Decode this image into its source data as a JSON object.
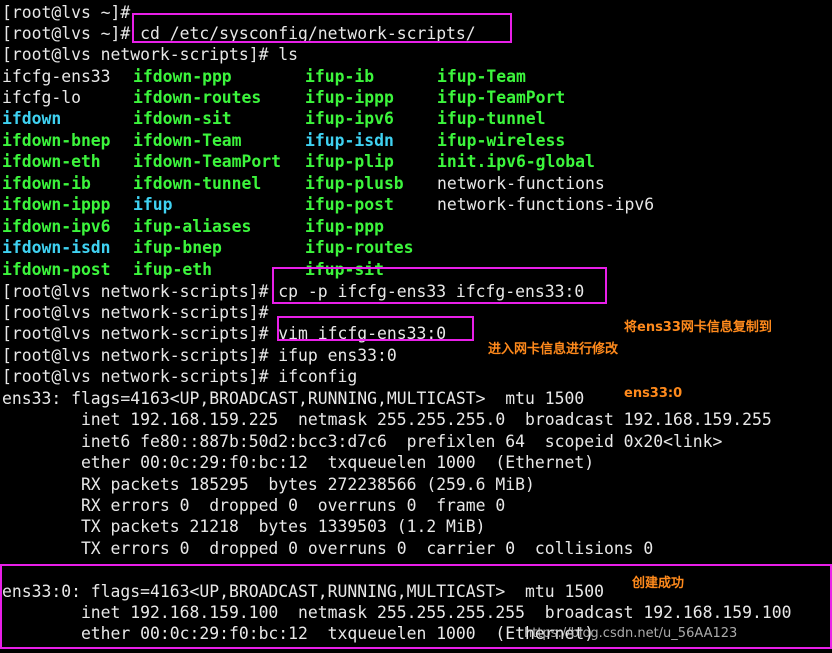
{
  "terminal": {
    "lines": [
      "[root@lvs ~]#",
      "[root@lvs ~]# cd /etc/sysconfig/network-scripts/",
      "[root@lvs network-scripts]# ls",
      "[root@lvs network-scripts]# cp -p ifcfg-ens33 ifcfg-ens33:0",
      "[root@lvs network-scripts]#",
      "[root@lvs network-scripts]# vim ifcfg-ens33:0",
      "[root@lvs network-scripts]# ifup ens33:0",
      "[root@lvs network-scripts]# ifconfig",
      "ens33: flags=4163<UP,BROADCAST,RUNNING,MULTICAST>  mtu 1500",
      "        inet 192.168.159.225  netmask 255.255.255.0  broadcast 192.168.159.255",
      "        inet6 fe80::887b:50d2:bcc3:d7c6  prefixlen 64  scopeid 0x20<link>",
      "        ether 00:0c:29:f0:bc:12  txqueuelen 1000  (Ethernet)",
      "        RX packets 185295  bytes 272238566 (259.6 MiB)",
      "        RX errors 0  dropped 0  overruns 0  frame 0",
      "        TX packets 21218  bytes 1339503 (1.2 MiB)",
      "        TX errors 0  dropped 0 overruns 0  carrier 0  collisions 0",
      "",
      "ens33:0: flags=4163<UP,BROADCAST,RUNNING,MULTICAST>  mtu 1500",
      "        inet 192.168.159.100  netmask 255.255.255.255  broadcast 192.168.159.100",
      "        ether 00:0c:29:f0:bc:12  txqueuelen 1000  (Ethernet)"
    ],
    "ls_columns": [
      [
        "ifcfg-ens33",
        "ifcfg-lo",
        "ifdown",
        "ifdown-bnep",
        "ifdown-eth",
        "ifdown-ib",
        "ifdown-ippp",
        "ifdown-ipv6",
        "ifdown-isdn",
        "ifdown-post"
      ],
      [
        "ifdown-ppp",
        "ifdown-routes",
        "ifdown-sit",
        "ifdown-Team",
        "ifdown-TeamPort",
        "ifdown-tunnel",
        "ifup",
        "ifup-aliases",
        "ifup-bnep",
        "ifup-eth"
      ],
      [
        "ifup-ib",
        "ifup-ippp",
        "ifup-ipv6",
        "ifup-isdn",
        "ifup-plip",
        "ifup-plusb",
        "ifup-post",
        "ifup-ppp",
        "ifup-routes",
        "ifup-sit"
      ],
      [
        "ifup-Team",
        "ifup-TeamPort",
        "ifup-tunnel",
        "ifup-wireless",
        "init.ipv6-global",
        "network-functions",
        "network-functions-ipv6"
      ]
    ],
    "ls_colors": {
      "plain": "#e8e8e8",
      "executable": "#3cf53c",
      "symlink": "#3fd2f2"
    }
  },
  "annotations": {
    "copy_note_line1": "将ens33网卡信息复制到",
    "copy_note_line2": "ens33:0",
    "edit_note": "进入网卡信息进行修改",
    "created_note": "创建成功",
    "box_color": "#e81fe8",
    "text_color": "#ff8a1c"
  },
  "watermark": "https://blog.csdn.net/u_56AA123"
}
